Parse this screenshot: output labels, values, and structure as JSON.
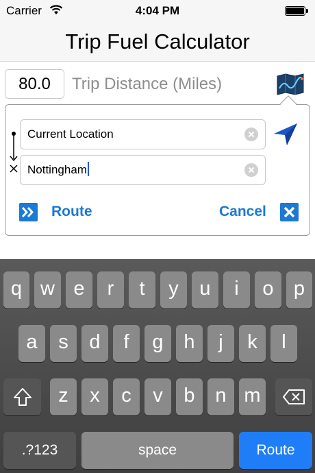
{
  "status_bar": {
    "carrier": "Carrier",
    "time": "4:04 PM"
  },
  "nav": {
    "title": "Trip Fuel Calculator"
  },
  "distance": {
    "value": "80.0",
    "label": "Trip Distance (Miles)"
  },
  "route_form": {
    "from_value": "Current Location",
    "to_value": "Nottingham",
    "route_label": "Route",
    "cancel_label": "Cancel"
  },
  "icons": {
    "wifi": "wifi-icon",
    "battery": "battery-icon",
    "map": "map-icon",
    "locate": "location-arrow-icon",
    "clear": "clear-circle-icon",
    "route": "double-chevron-right-icon",
    "cancel": "x-box-icon",
    "shift": "shift-arrow-icon",
    "backspace": "backspace-icon"
  },
  "colors": {
    "accent": "#1c79d4",
    "keyboard_return": "#1f7ef7"
  },
  "keyboard": {
    "row1": [
      "q",
      "w",
      "e",
      "r",
      "t",
      "y",
      "u",
      "i",
      "o",
      "p"
    ],
    "row2": [
      "a",
      "s",
      "d",
      "f",
      "g",
      "h",
      "j",
      "k",
      "l"
    ],
    "row3": [
      "z",
      "x",
      "c",
      "v",
      "b",
      "n",
      "m"
    ],
    "numbers_label": ".?123",
    "space_label": "space",
    "return_label": "Route"
  }
}
